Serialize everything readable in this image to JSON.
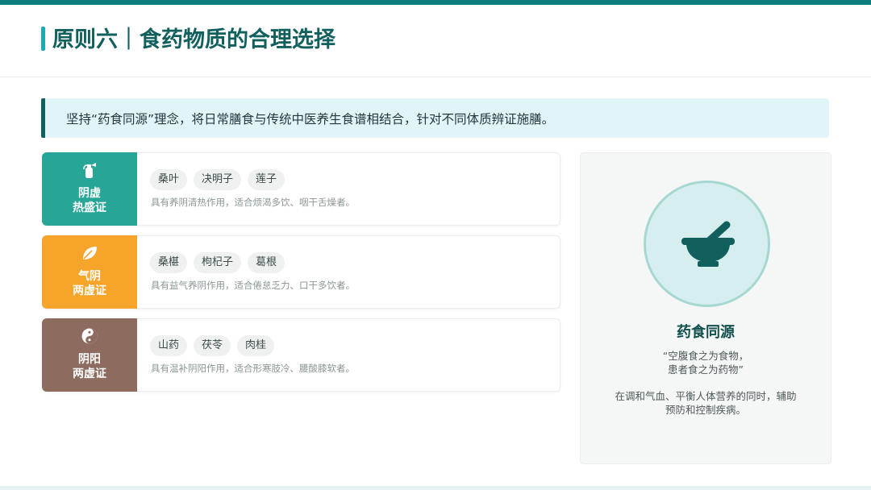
{
  "header": {
    "title": "原则六｜食药物质的合理选择"
  },
  "principle": {
    "text": "坚持“药食同源”理念，将日常膳食与传统中医养生食谱相结合，针对不同体质辨证施膳。"
  },
  "cards": [
    {
      "label_line1": "阴虚",
      "label_line2": "热盛证",
      "icon": "fire-extinguisher-icon",
      "color": "#27a597",
      "tags": [
        "桑叶",
        "决明子",
        "莲子"
      ],
      "desc": "具有养阴清热作用，适合烦渴多饮、咽干舌燥者。"
    },
    {
      "label_line1": "气阴",
      "label_line2": "两虚证",
      "icon": "leaf-icon",
      "color": "#f7a52a",
      "tags": [
        "桑椹",
        "枸杞子",
        "葛根"
      ],
      "desc": "具有益气养阴作用，适合倦怠乏力、口干多饮者。"
    },
    {
      "label_line1": "阴阳",
      "label_line2": "两虚证",
      "icon": "yin-yang-icon",
      "color": "#8d6b5e",
      "tags": [
        "山药",
        "茯苓",
        "肉桂"
      ],
      "desc": "具有温补阴阳作用，适合形寒肢冷、腰酸膝软者。"
    }
  ],
  "panel": {
    "icon": "mortar-pestle-icon",
    "title": "药食同源",
    "quote_line1": "“空腹食之为食物，",
    "quote_line2": "患者食之为药物”",
    "note_line1": "在调和气血、平衡人体营养的同时，辅助",
    "note_line2": "预防和控制疾病。"
  }
}
